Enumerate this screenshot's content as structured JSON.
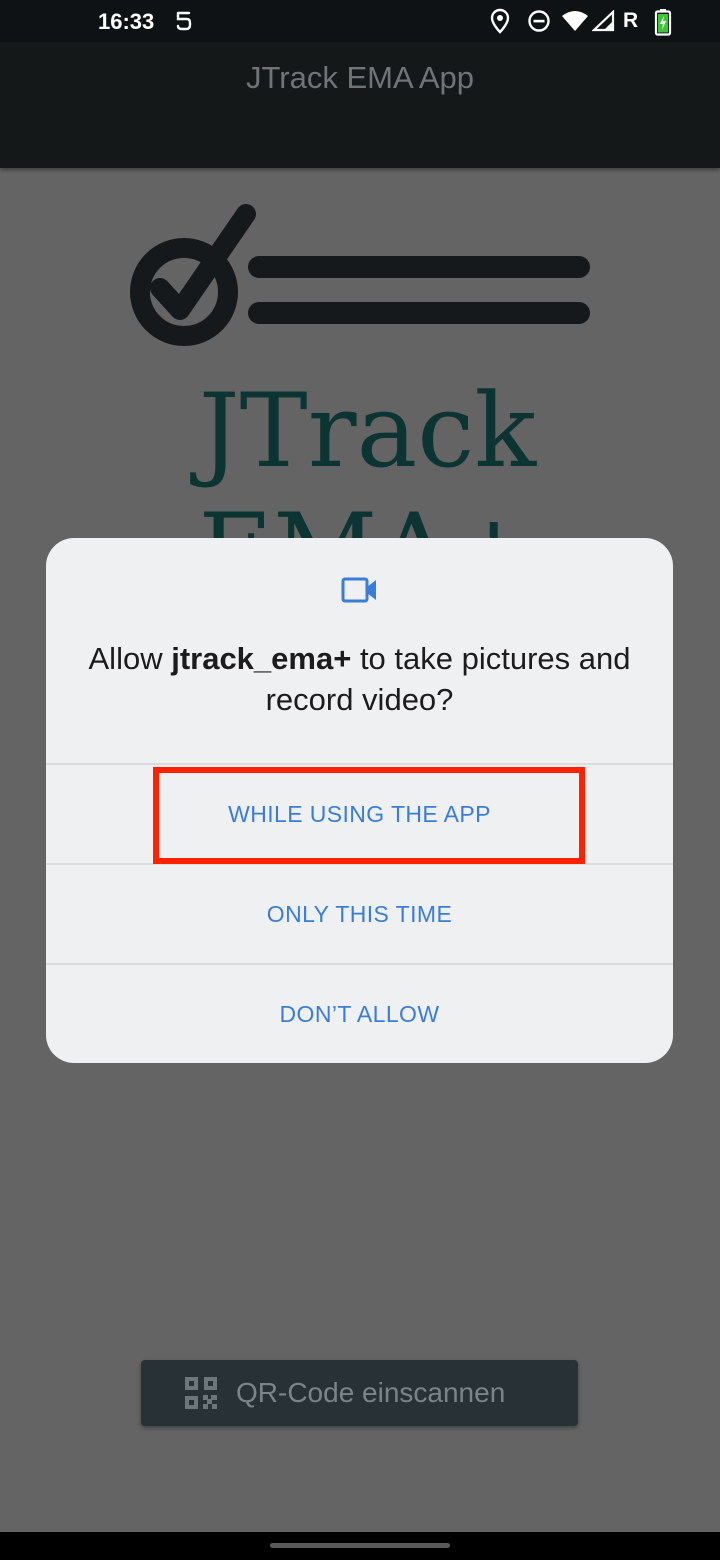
{
  "status_bar": {
    "time": "16:33",
    "roaming_label": "R",
    "icons": [
      "notification-icon",
      "location-icon",
      "do-not-disturb-icon",
      "wifi-icon",
      "signal-icon",
      "battery-charging-icon"
    ]
  },
  "app_bar": {
    "title": "JTrack EMA App"
  },
  "logo": {
    "wordmark": "JTrack EMA+",
    "icon": "checklist-icon",
    "color": "#0c3432"
  },
  "dialog": {
    "icon": "videocam-icon",
    "message_prefix": "Allow ",
    "app_name": "jtrack_ema+",
    "message_suffix": " to take pictures and record video?",
    "buttons": {
      "while_using": "WHILE USING THE APP",
      "only_this_time": "ONLY THIS TIME",
      "dont_allow": "DON’T ALLOW"
    },
    "accent_color": "#3a7dd8",
    "highlight_color": "#ff2200"
  },
  "qr_button": {
    "label": "QR-Code einscannen",
    "icon": "qr-code-icon"
  }
}
